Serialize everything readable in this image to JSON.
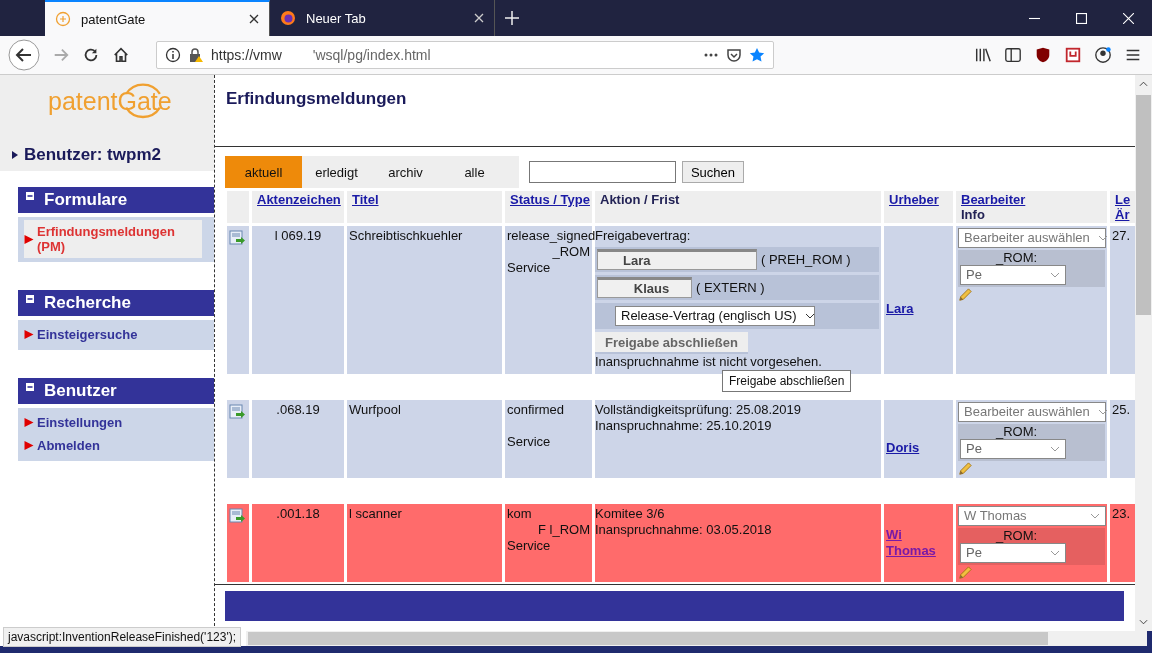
{
  "browser": {
    "tabs": [
      {
        "title": "patentGate",
        "selected": true,
        "kind": "site"
      },
      {
        "title": "Neuer Tab",
        "selected": false,
        "kind": "firefox"
      }
    ],
    "url": [
      "https://vmw",
      "'wsql/pg/index.html"
    ]
  },
  "sidebar": {
    "logo": [
      "patent",
      "Gate"
    ],
    "user": "Benutzer: twpm2",
    "sections": [
      {
        "title": "Formulare",
        "items": [
          {
            "label": "Erfindungsmeldungen (PM)",
            "selected": true
          }
        ]
      },
      {
        "title": "Recherche",
        "items": [
          {
            "label": "Einsteigersuche",
            "selected": false
          }
        ]
      },
      {
        "title": "Benutzer",
        "items": [
          {
            "label": "Einstellungen",
            "selected": false
          },
          {
            "label": "Abmelden",
            "selected": false
          }
        ]
      }
    ]
  },
  "main": {
    "title": "Erfindungsmeldungen",
    "filters": [
      {
        "label": "aktuell",
        "selected": true
      },
      {
        "label": "erledigt",
        "selected": false
      },
      {
        "label": "archiv",
        "selected": false
      },
      {
        "label": "alle",
        "selected": false
      }
    ],
    "search_button": "Suchen",
    "columns": [
      {
        "label": "Aktenzeichen",
        "link": true
      },
      {
        "label": "Titel",
        "link": true
      },
      {
        "label": "Status / Type",
        "link": true
      },
      {
        "label": "Aktion / Frist",
        "link": false
      },
      {
        "label": "Urheber",
        "link": true
      },
      {
        "label": "Bearbeiter",
        "sub": "Info",
        "link": true
      },
      {
        "label": "Le",
        "sub": "Är",
        "link": true
      }
    ],
    "rows": [
      {
        "color": "#cdd5e8",
        "file_no": "l     069.19",
        "title": "Schreibtischkuehler",
        "status": [
          "release_signed",
          "_ROM",
          "Service"
        ],
        "action": {
          "kind": "release",
          "label": "Freigabevertrag:",
          "approvers": [
            {
              "name": "Lara",
              "org": "( PREH_ROM )"
            },
            {
              "name": "Klaus",
              "org": "( EXTERN )"
            }
          ],
          "contract": "Release-Vertrag (englisch US)",
          "button": "Freigabe abschließen",
          "note": "Inanspruchnahme ist nicht vorgesehen.",
          "tooltip": "Freigabe abschließen"
        },
        "author": "Lara",
        "author_visited": false,
        "assignee": "Bearbeiter auswählen",
        "rom_label": "_ROM:",
        "rom_value": "Pe",
        "changed": "27."
      },
      {
        "color": "#cdd5e8",
        "file_no": ".068.19",
        "title": "Wurfpool",
        "status": [
          "confirmed",
          "Service"
        ],
        "action": {
          "kind": "dates",
          "lines": [
            "Vollständigkeitsprüfung: 25.08.2019",
            "Inanspruchnahme: 25.10.2019"
          ]
        },
        "author": "Doris",
        "author_visited": false,
        "assignee": "Bearbeiter auswählen",
        "rom_label": "_ROM:",
        "rom_value": "Pe",
        "changed": "25."
      },
      {
        "color": "#ff6b6b",
        "file_no": ".001.18",
        "title": "l                scanner",
        "status": [
          "kom",
          "F      l_ROM",
          "Service"
        ],
        "action": {
          "kind": "dates",
          "lines": [
            "Komitee 3/6",
            "Inanspruchnahme: 03.05.2018"
          ]
        },
        "author": "Wi Thomas",
        "author_visited": true,
        "assignee": "W         Thomas",
        "rom_label": "_ROM:",
        "rom_value": "Pe",
        "changed": "23."
      }
    ]
  },
  "status_bar": "javascript:InventionReleaseFinished('123');"
}
